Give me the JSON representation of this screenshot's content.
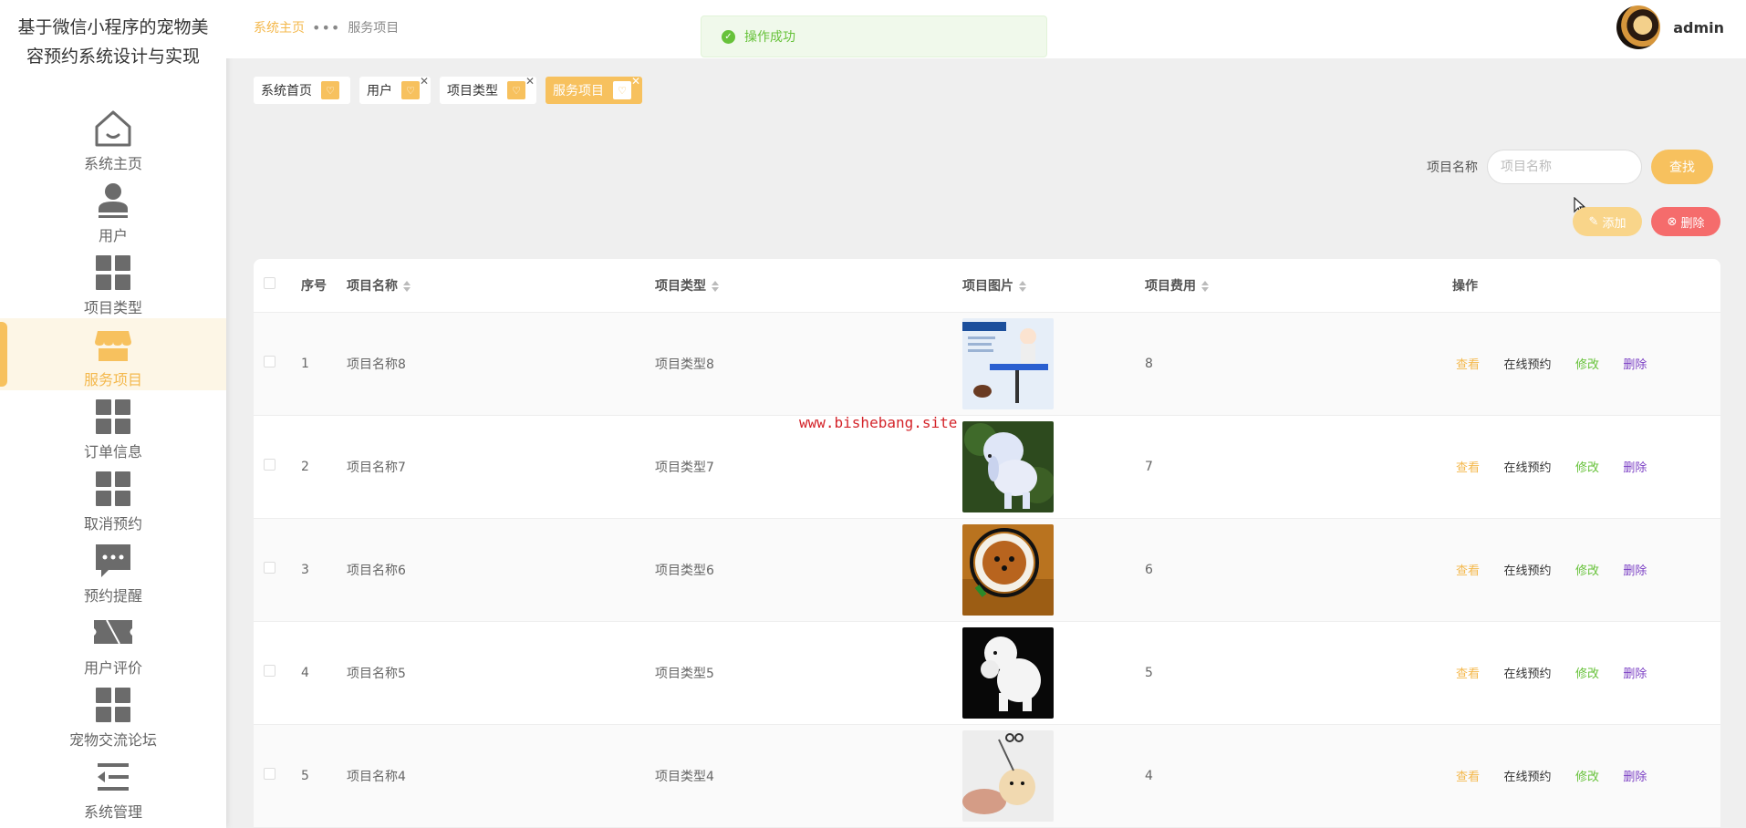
{
  "sidebar": {
    "title": "基于微信小程序的宠物美容预约系统设计与实现",
    "items": [
      {
        "label": "系统主页",
        "icon": "home-icon"
      },
      {
        "label": "用户",
        "icon": "user-icon"
      },
      {
        "label": "项目类型",
        "icon": "grid-icon"
      },
      {
        "label": "服务项目",
        "icon": "shop-icon",
        "active": true
      },
      {
        "label": "订单信息",
        "icon": "grid-icon"
      },
      {
        "label": "取消预约",
        "icon": "grid-icon"
      },
      {
        "label": "预约提醒",
        "icon": "chat-icon"
      },
      {
        "label": "用户评价",
        "icon": "ticket-icon"
      },
      {
        "label": "宠物交流论坛",
        "icon": "grid-icon"
      },
      {
        "label": "系统管理",
        "icon": "menu-list-icon"
      }
    ]
  },
  "header": {
    "breadcrumb_home": "系统主页",
    "breadcrumb_sep": "•••",
    "breadcrumb_current": "服务项目",
    "username": "admin"
  },
  "toast": {
    "message": "操作成功"
  },
  "tags": [
    {
      "label": "系统首页",
      "closable": false
    },
    {
      "label": "用户",
      "closable": true
    },
    {
      "label": "项目类型",
      "closable": true
    },
    {
      "label": "服务项目",
      "closable": true,
      "active": true
    }
  ],
  "search": {
    "label": "项目名称",
    "placeholder": "项目名称",
    "button": "查找"
  },
  "actions": {
    "add": "添加",
    "delete": "删除"
  },
  "table": {
    "columns": [
      "序号",
      "项目名称",
      "项目类型",
      "项目图片",
      "项目费用",
      "操作"
    ],
    "rows": [
      {
        "index": "1",
        "name": "项目名称8",
        "type": "项目类型8",
        "fee": "8"
      },
      {
        "index": "2",
        "name": "项目名称7",
        "type": "项目类型7",
        "fee": "7"
      },
      {
        "index": "3",
        "name": "项目名称6",
        "type": "项目类型6",
        "fee": "6"
      },
      {
        "index": "4",
        "name": "项目名称5",
        "type": "项目类型5",
        "fee": "5"
      },
      {
        "index": "5",
        "name": "项目名称4",
        "type": "项目类型4",
        "fee": "4"
      }
    ],
    "ops": {
      "view": "查看",
      "book": "在线预约",
      "edit": "修改",
      "delete": "删除"
    }
  },
  "watermark": "www.bishebang.site",
  "colors": {
    "accent": "#f7c15e",
    "danger": "#f56c6c",
    "success": "#67c23a",
    "purple": "#7b3fc4"
  }
}
